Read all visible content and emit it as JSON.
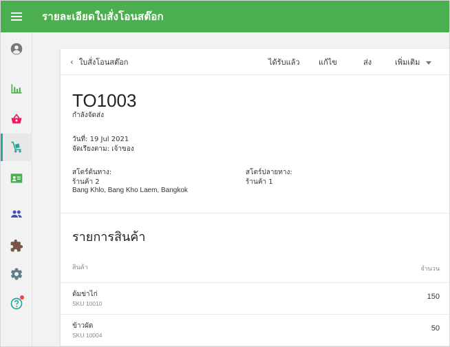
{
  "appbar": {
    "title": "รายละเอียดใบสั่งโอนสต๊อก"
  },
  "colors": {
    "primary": "#4bae4f",
    "accent": "#26a69a",
    "badge": "#f44336"
  },
  "sidebar": {
    "items": [
      {
        "icon": "account-circle-icon",
        "color": "#777777"
      },
      {
        "icon": "bar-chart-icon",
        "color": "#4bae4f"
      },
      {
        "icon": "basket-icon",
        "color": "#e91e63"
      },
      {
        "icon": "dolly-icon",
        "color": "#26a69a",
        "active": true
      },
      {
        "icon": "contact-card-icon",
        "color": "#4bae4f"
      },
      {
        "icon": "people-icon",
        "color": "#3f51b5"
      },
      {
        "icon": "puzzle-icon",
        "color": "#795548"
      },
      {
        "icon": "gear-icon",
        "color": "#607d8b"
      },
      {
        "icon": "help-icon",
        "color": "#26a69a",
        "badge": true
      }
    ]
  },
  "toolbar": {
    "back_label": "ใบสั่งโอนสต๊อก",
    "received_label": "ได้รับแล้ว",
    "edit_label": "แก้ไข",
    "send_label": "ส่ง",
    "more_label": "เพิ่มเติม"
  },
  "order": {
    "number": "TO1003",
    "status": "กำลังจัดส่ง",
    "date": "วันที่: 19 Jul 2021",
    "arranged_by": "จัดเรียงตาม: เจ้าของ",
    "source_label": "สโตร์ต้นทาง:",
    "source_name": "ร้านค้า 2",
    "source_address": "Bang Khlo, Bang Kho Laem, Bangkok",
    "dest_label": "สโตร์ปลายทาง:",
    "dest_name": "ร้านค้า 1"
  },
  "items_section": {
    "title": "รายการสินค้า",
    "col_product": "สินค้า",
    "col_qty": "จำนวน",
    "rows": [
      {
        "name": "ต้มข่าไก่",
        "sku": "SKU 10010",
        "qty": "150"
      },
      {
        "name": "ข้าวผัด",
        "sku": "SKU 10004",
        "qty": "50"
      }
    ]
  }
}
